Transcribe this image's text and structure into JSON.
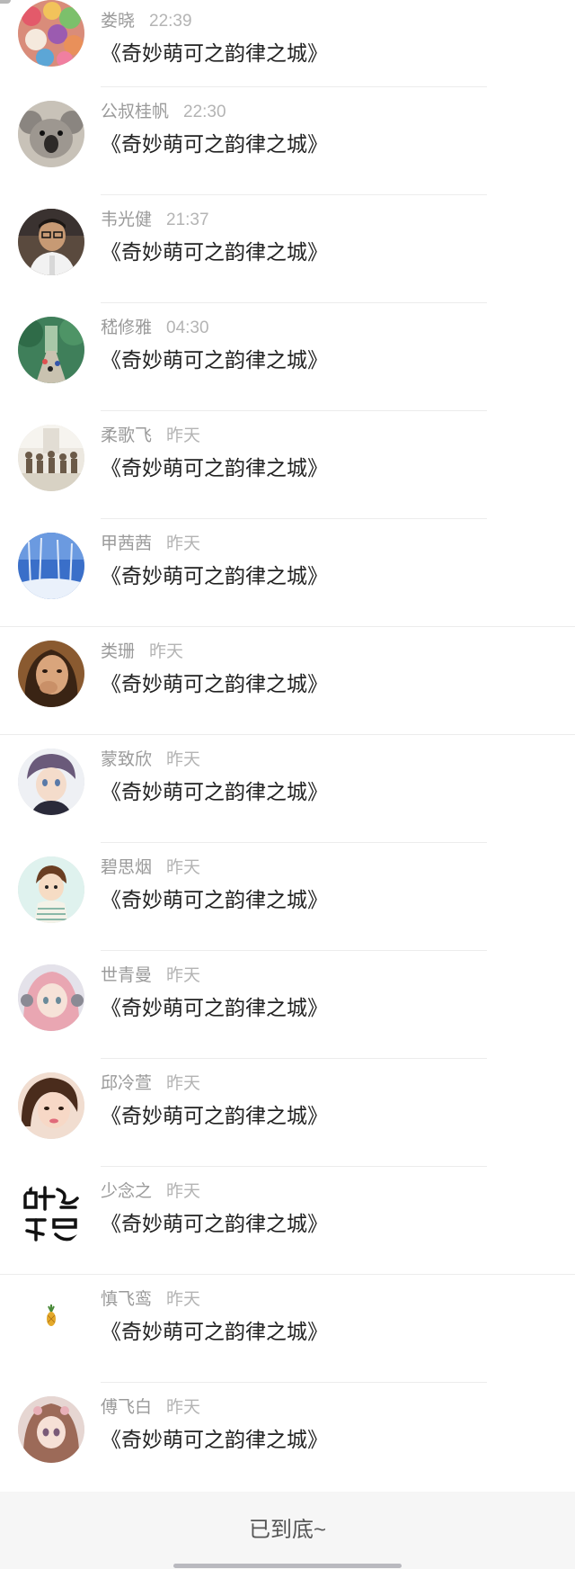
{
  "list": {
    "items": [
      {
        "name": "娄晓",
        "time": "22:39",
        "message": "《奇妙萌可之韵律之城》",
        "avatar": "candy-avatar"
      },
      {
        "name": "公叔桂帆",
        "time": "22:30",
        "message": "《奇妙萌可之韵律之城》",
        "avatar": "koala-avatar"
      },
      {
        "name": "韦光健",
        "time": "21:37",
        "message": "《奇妙萌可之韵律之城》",
        "avatar": "boy-glasses-avatar"
      },
      {
        "name": "嵇修雅",
        "time": "04:30",
        "message": "《奇妙萌可之韵律之城》",
        "avatar": "park-avatar"
      },
      {
        "name": "柔歌飞",
        "time": "昨天",
        "message": "《奇妙萌可之韵律之城》",
        "avatar": "group-avatar"
      },
      {
        "name": "甲茜茜",
        "time": "昨天",
        "message": "《奇妙萌可之韵律之城》",
        "avatar": "snow-forest-avatar"
      },
      {
        "name": "类珊",
        "time": "昨天",
        "message": "《奇妙萌可之韵律之城》",
        "avatar": "woman-avatar"
      },
      {
        "name": "蒙致欣",
        "time": "昨天",
        "message": "《奇妙萌可之韵律之城》",
        "avatar": "anime-boy-avatar"
      },
      {
        "name": "碧思烟",
        "time": "昨天",
        "message": "《奇妙萌可之韵律之城》",
        "avatar": "cartoon-boy-avatar"
      },
      {
        "name": "世青曼",
        "time": "昨天",
        "message": "《奇妙萌可之韵律之城》",
        "avatar": "anime-girl-avatar"
      },
      {
        "name": "邱冷萱",
        "time": "昨天",
        "message": "《奇妙萌可之韵律之城》",
        "avatar": "girl-selfie-avatar"
      },
      {
        "name": "少念之",
        "time": "昨天",
        "message": "《奇妙萌可之韵律之城》",
        "avatar": "calligraphy-avatar"
      },
      {
        "name": "慎飞鸾",
        "time": "昨天",
        "message": "《奇妙萌可之韵律之城》",
        "avatar": "pineapple-avatar"
      },
      {
        "name": "傅飞白",
        "time": "昨天",
        "message": "《奇妙萌可之韵律之城》",
        "avatar": "doll-avatar"
      }
    ]
  },
  "footer": {
    "end_text": "已到底~"
  },
  "colors": {
    "name": "#9a9a9a",
    "time": "#b4b4b4",
    "message": "#222222",
    "divider": "#ececec",
    "footer_bg": "#f6f6f6"
  }
}
